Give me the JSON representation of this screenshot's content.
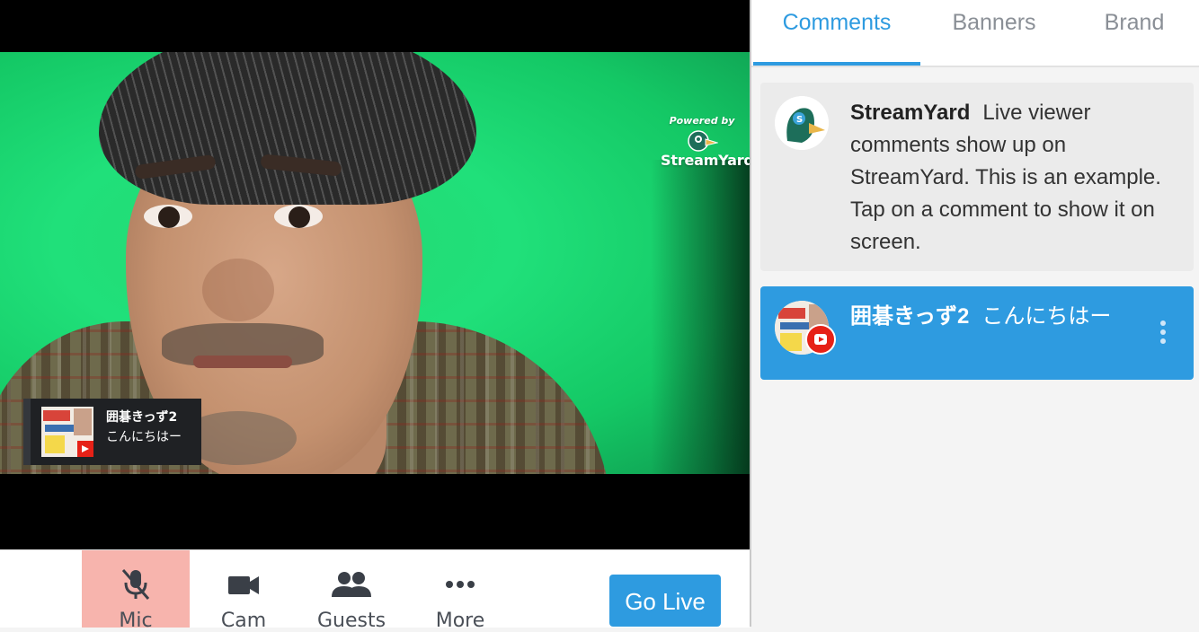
{
  "watermark": {
    "powered_by": "Powered by",
    "brand": "StreamYard"
  },
  "overlay": {
    "author": "囲碁きっず2",
    "message": "こんにちはー"
  },
  "controls": {
    "mic_label": "Mic",
    "cam_label": "Cam",
    "guests_label": "Guests",
    "more_label": "More",
    "go_live_label": "Go Live"
  },
  "tabs": [
    {
      "label": "Comments",
      "active": true
    },
    {
      "label": "Banners",
      "active": false
    },
    {
      "label": "Brand",
      "active": false
    }
  ],
  "comments": [
    {
      "author": "StreamYard",
      "text": "Live viewer comments show up on StreamYard. This is an example. Tap on a comment to show it on screen.",
      "highlighted": false
    },
    {
      "author": "囲碁きっず2",
      "text": "こんにちはー",
      "highlighted": true,
      "platform": "youtube-icon"
    }
  ],
  "colors": {
    "accent": "#2e9be0",
    "mic_muted_bg": "#f7b4ad",
    "youtube": "#e62117"
  }
}
